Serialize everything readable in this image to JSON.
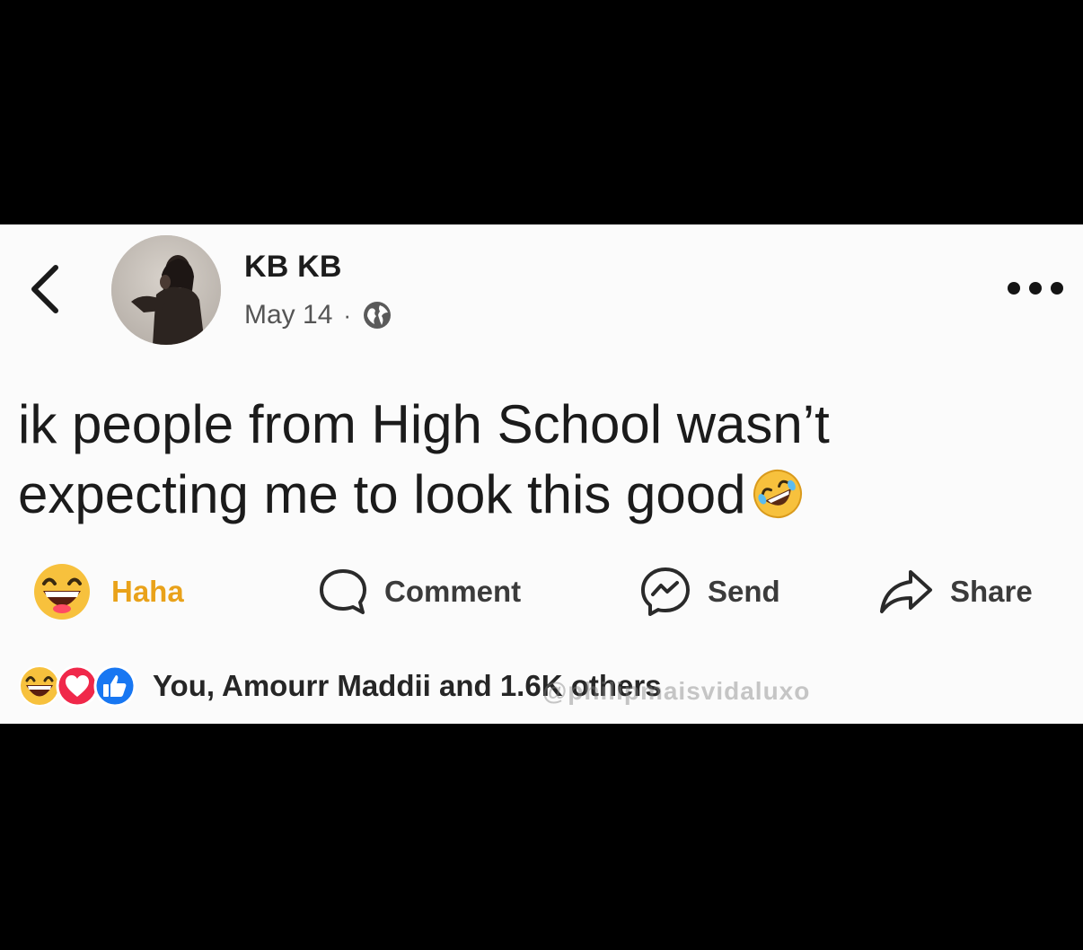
{
  "post": {
    "author": "KB KB",
    "date": "May 14",
    "separator": "·",
    "audience_icon": "globe-icon",
    "text_line1": "ik people from High School wasn’t",
    "text_line2": "expecting me to look this good",
    "inline_emoji": "rolling-on-floor-laughing-emoji"
  },
  "actions": {
    "reaction_label": "Haha",
    "comment_label": "Comment",
    "send_label": "Send",
    "share_label": "Share"
  },
  "reactions": {
    "icons": [
      "haha-icon",
      "love-icon",
      "like-icon"
    ],
    "summary": "You, Amourr Maddii and 1.6K others"
  },
  "watermark": "@philipmaisvidaluxo",
  "colors": {
    "card_background": "#fbfbfb",
    "page_background": "#000000",
    "haha_label": "#e9a21a",
    "like_blue": "#1877f2",
    "love_red": "#f0284a",
    "haha_yellow": "#f7c13d"
  }
}
